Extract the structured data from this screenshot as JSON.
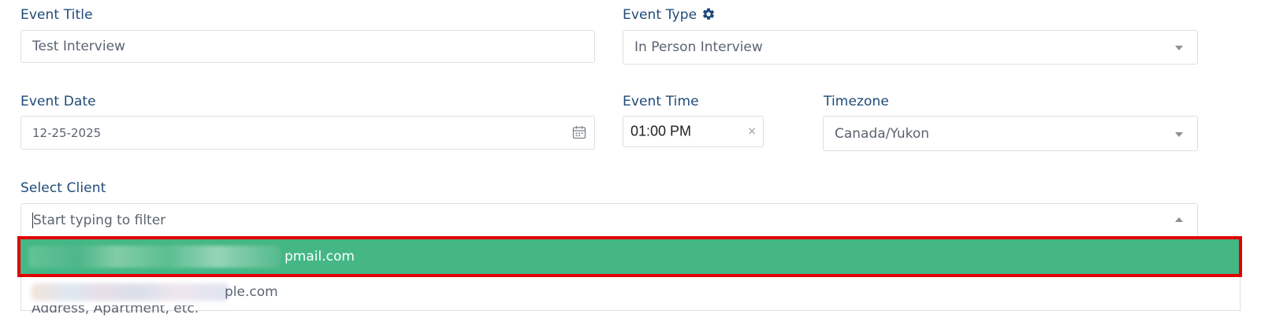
{
  "event_title": {
    "label": "Event Title",
    "value": "Test Interview"
  },
  "event_type": {
    "label": "Event Type",
    "value": "In Person Interview",
    "icon": "gear-icon"
  },
  "event_date": {
    "label": "Event Date",
    "value": "12-25-2025",
    "icon": "calendar-icon"
  },
  "event_time": {
    "label": "Event Time",
    "value": "01:00 PM",
    "clear": "×"
  },
  "timezone": {
    "label": "Timezone",
    "value": "Canada/Yukon"
  },
  "select_client": {
    "label": "Select Client",
    "placeholder": "Start typing to filter",
    "options": [
      {
        "text": "pmail.com",
        "selected": true
      },
      {
        "text": "ple.com",
        "selected": false
      }
    ]
  },
  "address": {
    "placeholder": "Address, Apartment, etc."
  },
  "colors": {
    "label": "#1f4a78",
    "selected_bg": "#44b785",
    "highlight_border": "#e00000"
  }
}
